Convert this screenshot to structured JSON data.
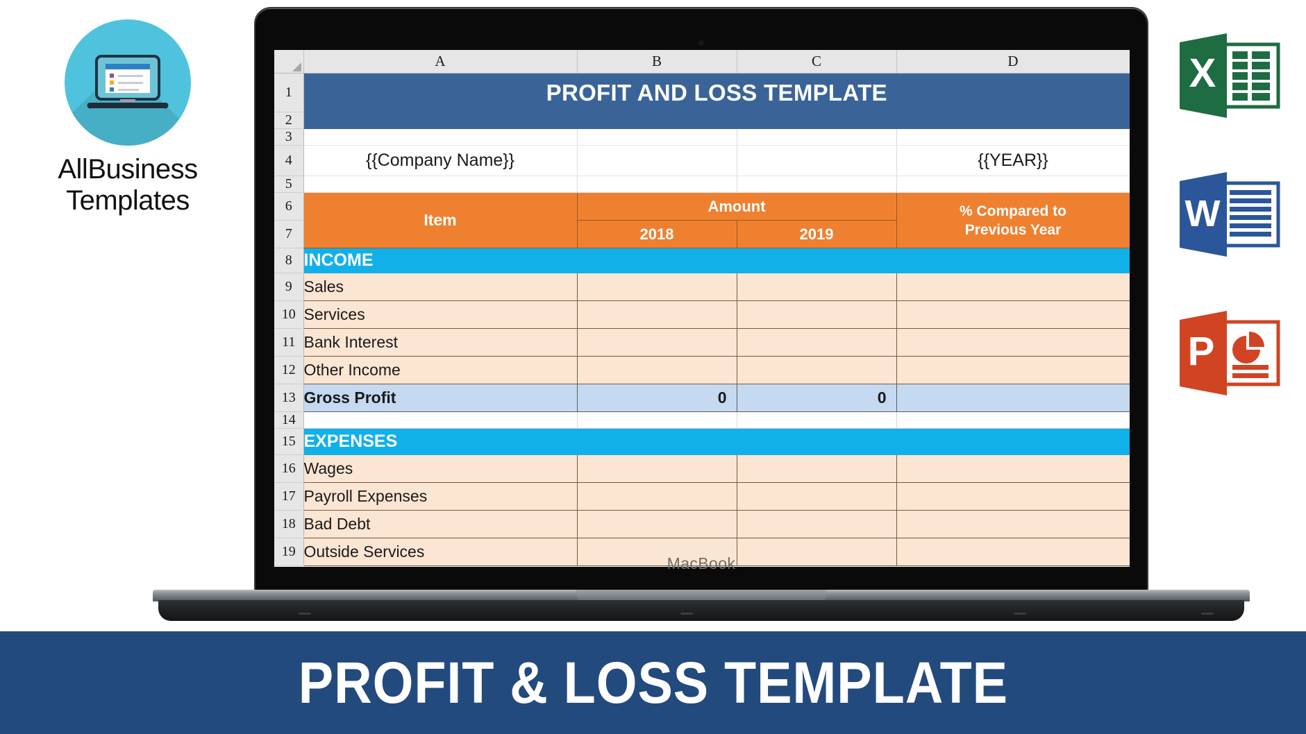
{
  "brand": {
    "name_line1": "AllBusiness",
    "name_line2": "Templates",
    "logo_icon": "laptop-document-icon",
    "logo_color": "#4fc3dd"
  },
  "laptop": {
    "model_label": "MacBook",
    "camera_icon": "webcam-icon"
  },
  "spreadsheet": {
    "column_headers": [
      "A",
      "B",
      "C",
      "D"
    ],
    "row_headers": [
      "1",
      "2",
      "3",
      "4",
      "5",
      "6",
      "7",
      "8",
      "9",
      "10",
      "11",
      "12",
      "13",
      "14",
      "15",
      "16",
      "17",
      "18",
      "19"
    ],
    "title": "PROFIT AND LOSS TEMPLATE",
    "company_name": "{{Company Name}}",
    "year_placeholder": "{{YEAR}}",
    "header": {
      "item": "Item",
      "amount": "Amount",
      "year_prev": "2018",
      "year_curr": "2019",
      "percent_compared_line1": "% Compared to",
      "percent_compared_line2": "Previous Year"
    },
    "sections": [
      {
        "row": "8",
        "label": "INCOME",
        "rows": [
          {
            "row": "9",
            "item": "Sales",
            "y2018": "",
            "y2019": "",
            "pct": ""
          },
          {
            "row": "10",
            "item": "Services",
            "y2018": "",
            "y2019": "",
            "pct": ""
          },
          {
            "row": "11",
            "item": "Bank Interest",
            "y2018": "",
            "y2019": "",
            "pct": ""
          },
          {
            "row": "12",
            "item": "Other Income",
            "y2018": "",
            "y2019": "",
            "pct": ""
          }
        ],
        "total": {
          "row": "13",
          "item": "Gross Profit",
          "y2018": "0",
          "y2019": "0",
          "pct": ""
        }
      },
      {
        "row": "15",
        "label": "EXPENSES",
        "rows": [
          {
            "row": "16",
            "item": "Wages",
            "y2018": "",
            "y2019": "",
            "pct": ""
          },
          {
            "row": "17",
            "item": "Payroll Expenses",
            "y2018": "",
            "y2019": "",
            "pct": ""
          },
          {
            "row": "18",
            "item": "Bad Debt",
            "y2018": "",
            "y2019": "",
            "pct": ""
          },
          {
            "row": "19",
            "item": "Outside Services",
            "y2018": "",
            "y2019": "",
            "pct": ""
          }
        ]
      }
    ],
    "colors": {
      "title_band": "#3a6498",
      "header_orange": "#ef8030",
      "section_blue": "#12b0e8",
      "row_peach": "#fbe5d3",
      "total_blue": "#c5d9f1"
    }
  },
  "office_icons": [
    {
      "name": "excel-icon",
      "letter": "X",
      "color": "#1e6c41"
    },
    {
      "name": "word-icon",
      "letter": "W",
      "color": "#2b579a"
    },
    {
      "name": "powerpoint-icon",
      "letter": "P",
      "color": "#d04423"
    }
  ],
  "banner": {
    "text": "PROFIT & LOSS TEMPLATE",
    "background": "#234a7d"
  }
}
